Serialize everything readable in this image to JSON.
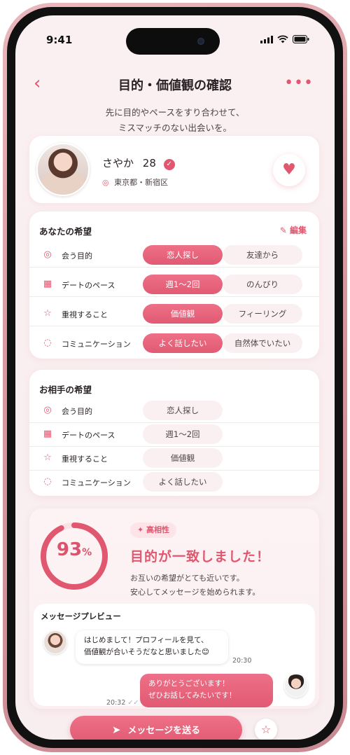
{
  "status": {
    "time": "9:41"
  },
  "header": {
    "title": "目的・価値観の確認",
    "back_icon": "chevron-left-icon",
    "more_icon": "more-dots-icon"
  },
  "intro": {
    "line1": "先に目的やペースをすり合わせて、",
    "line2": "ミスマッチのない出会いを。"
  },
  "profile": {
    "name": "さやか",
    "age": "28",
    "location": "東京都・新宿区"
  },
  "my_prefs": {
    "title": "あなたの希望",
    "edit_label": "編集",
    "rows": [
      {
        "label": "会う目的",
        "icon": "target-icon",
        "selected": "恋人探し",
        "other": "友達から"
      },
      {
        "label": "デートのペース",
        "icon": "calendar-icon",
        "selected": "週1〜2回",
        "other": "のんびり"
      },
      {
        "label": "重視すること",
        "icon": "star-icon",
        "selected": "価値観",
        "other": "フィーリング"
      },
      {
        "label": "コミュニケーション",
        "icon": "chat-icon",
        "selected": "よく話したい",
        "other": "自然体でいたい"
      }
    ]
  },
  "their_prefs": {
    "title": "お相手の希望",
    "rows": [
      {
        "label": "会う目的",
        "icon": "target-icon",
        "value": "恋人探し"
      },
      {
        "label": "デートのペース",
        "icon": "calendar-icon",
        "value": "週1〜2回"
      },
      {
        "label": "重視すること",
        "icon": "star-icon",
        "value": "価値観"
      },
      {
        "label": "コミュニケーション",
        "icon": "chat-icon",
        "value": "よく話したい"
      }
    ]
  },
  "match": {
    "percent": 93,
    "percent_number": "93",
    "percent_unit": "%",
    "badge": "高相性",
    "headline": "目的が一致しました！",
    "desc1": "お互いの希望がとても近いです。",
    "desc2": "安心してメッセージを始められます。"
  },
  "preview": {
    "title": "メッセージプレビュー",
    "incoming": {
      "line1": "はじめまして！プロフィールを見て、",
      "line2": "価値観が合いそうだなと思いました😊",
      "time": "20:30"
    },
    "outgoing": {
      "line1": "ありがとうございます！",
      "line2": "ぜひお話してみたいです！",
      "time": "20:32"
    }
  },
  "cta": {
    "send_label": "メッセージを送る"
  },
  "colors": {
    "accent": "#e0576f",
    "background": "#fbf0f1"
  }
}
